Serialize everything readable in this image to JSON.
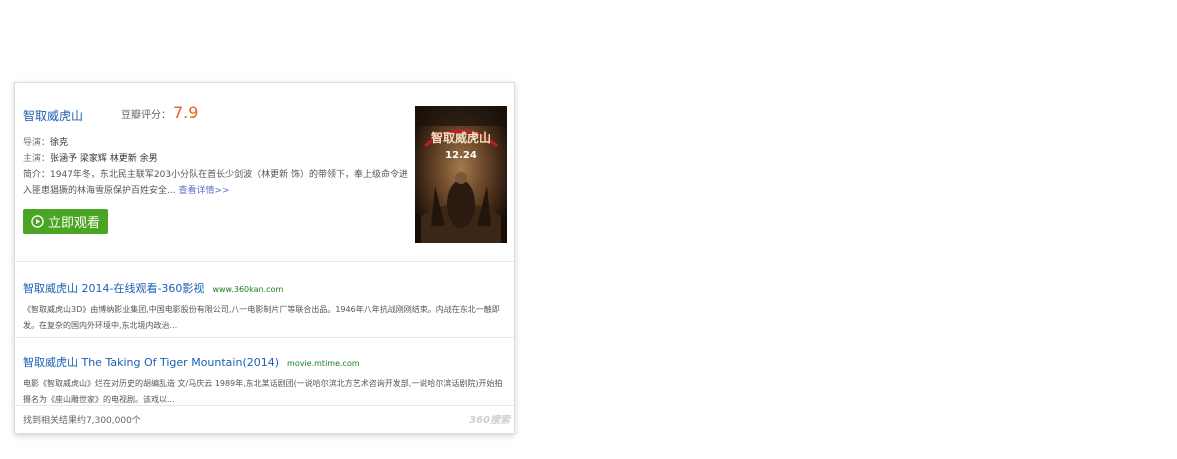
{
  "movie": {
    "title": "智取威虎山",
    "rating_label": "豆瓣评分：",
    "rating_value": "7.9",
    "director_label": "导演：",
    "director": "徐克",
    "cast_label": "主演：",
    "cast": "张涵予 梁家辉 林更新 余男",
    "synopsis_label": "简介：",
    "synopsis": "1947年冬，东北民主联军203小分队在首长少剑波（林更新 饰）的带领下，奉上级命令进入匪患猖獗的林海雪原保护百姓安全...",
    "more_label": "查看详情>>",
    "watch_label": "立即观看",
    "poster_title": "智取威虎山",
    "poster_date": "12.24"
  },
  "results": [
    {
      "title": "智取威虎山 2014-在线观看-360影视",
      "url": "www.360kan.com",
      "desc": "《智取威虎山3D》由博纳影业集团,中国电影股份有限公司,八一电影制片厂等联合出品。1946年八年抗战刚刚结束。内战在东北一触即发。在复杂的国内外环境中,东北境内政治..."
    },
    {
      "title": "智取威虎山 The Taking Of Tiger Mountain(2014)",
      "url": "movie.mtime.com",
      "desc": "电影《智取威虎山》烂在对历史的胡编乱造 文/马庆云 1989年,东北某话剧团(一说哈尔滨北方艺术咨询开发部,一说哈尔滨话剧院)开始拍摄名为《座山雕世家》的电视剧。该戏以..."
    }
  ],
  "footer": {
    "count": "找到相关结果约7,300,000个",
    "brand": "360搜索"
  },
  "colors": {
    "link": "#1a5fb4",
    "score": "#e8601c",
    "watch_button": "#4ba524",
    "url": "#1b7d1b"
  }
}
